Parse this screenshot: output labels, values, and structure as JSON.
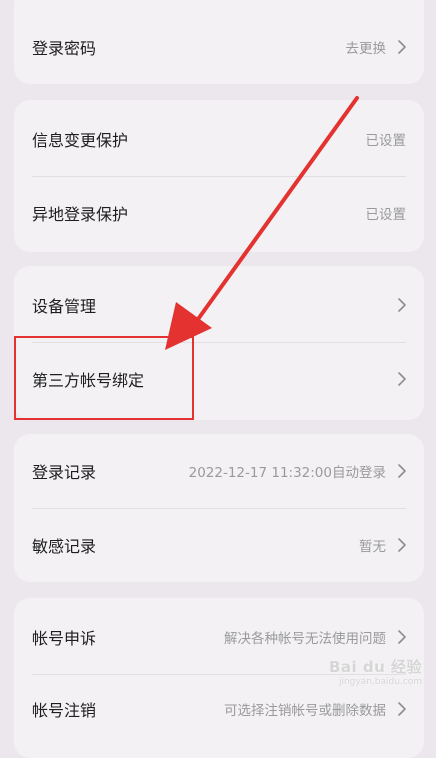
{
  "sections": [
    {
      "rows": [
        {
          "label": "登录密码",
          "value": "去更换",
          "chevron": true
        }
      ]
    },
    {
      "rows": [
        {
          "label": "信息变更保护",
          "value": "已设置",
          "chevron": false
        },
        {
          "label": "异地登录保护",
          "value": "已设置",
          "chevron": false
        }
      ]
    },
    {
      "rows": [
        {
          "label": "设备管理",
          "value": "",
          "chevron": true
        },
        {
          "label": "第三方帐号绑定",
          "value": "",
          "chevron": true
        }
      ]
    },
    {
      "rows": [
        {
          "label": "登录记录",
          "value": "2022-12-17 11:32:00自动登录",
          "chevron": true
        },
        {
          "label": "敏感记录",
          "value": "暂无",
          "chevron": true
        }
      ]
    },
    {
      "rows": [
        {
          "label": "帐号申诉",
          "value": "解决各种帐号无法使用问题",
          "chevron": true
        },
        {
          "label": "帐号注销",
          "value": "可选择注销帐号或删除数据",
          "chevron": true
        }
      ]
    }
  ],
  "watermark": {
    "brand": "Bai du 经验",
    "url": "jingyan.baidu.com"
  },
  "colors": {
    "highlight": "#e3322f",
    "background": "#ebe7ec",
    "card": "#f3f1f4"
  }
}
